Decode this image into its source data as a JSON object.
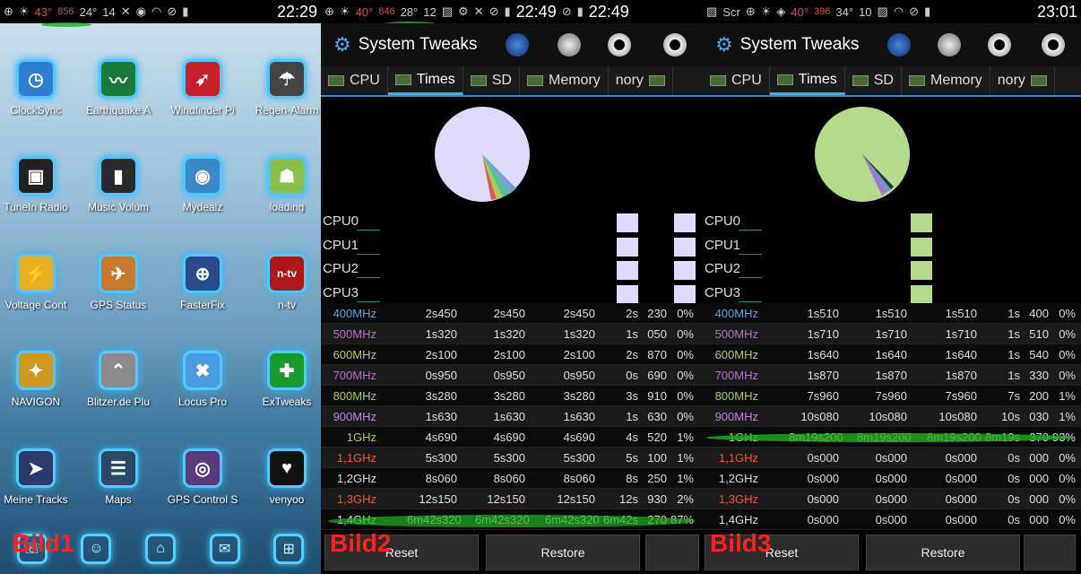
{
  "bild1": {
    "label": "Bild1",
    "statusbar": {
      "temp": "43°",
      "mah": "856",
      "b": "24°",
      "c": "14",
      "time": "22:29"
    },
    "apps": [
      {
        "label": "ClockSync",
        "icon": "clock-icon",
        "glyph": "◷",
        "color": "#2f7fd0"
      },
      {
        "label": "Earthquake A",
        "icon": "seismograph-icon",
        "glyph": "〰",
        "color": "#1a7a3a"
      },
      {
        "label": "Windfinder Pi",
        "icon": "windfinder-icon",
        "glyph": "➶",
        "color": "#c8202a"
      },
      {
        "label": "Regen-Alarm",
        "icon": "rain-cloud-icon",
        "glyph": "☂",
        "color": "#444"
      },
      {
        "label": "TuneIn Radio",
        "icon": "radio-icon",
        "glyph": "▣",
        "color": "#222"
      },
      {
        "label": "Music Volum",
        "icon": "equalizer-icon",
        "glyph": "▮",
        "color": "#2a2a2a"
      },
      {
        "label": "Mydealz",
        "icon": "crocodile-icon",
        "glyph": "◉",
        "color": "#3a88c8"
      },
      {
        "label": "loading",
        "icon": "android-icon",
        "glyph": "☗",
        "color": "#8ac04a"
      },
      {
        "label": "Voltage Cont",
        "icon": "voltage-icon",
        "glyph": "⚡",
        "color": "#e8b020"
      },
      {
        "label": "GPS Status",
        "icon": "gps-status-icon",
        "glyph": "✈",
        "color": "#c87a2a"
      },
      {
        "label": "FasterFix",
        "icon": "crosshair-icon",
        "glyph": "⊕",
        "color": "#2a4a8a"
      },
      {
        "label": "n-tv",
        "icon": "ntv-icon",
        "glyph": "n-tv",
        "color": "#b01818"
      },
      {
        "label": "NAVIGON",
        "icon": "navigon-icon",
        "glyph": "✦",
        "color": "#d09a20"
      },
      {
        "label": "Blitzer.de Plu",
        "icon": "blitzer-icon",
        "glyph": "⌃",
        "color": "#8a8a8a"
      },
      {
        "label": "Locus Pro",
        "icon": "map-icon",
        "glyph": "✖",
        "color": "#4a9ae0"
      },
      {
        "label": "ExTweaks",
        "icon": "plus-icon",
        "glyph": "✚",
        "color": "#1a9a2a"
      },
      {
        "label": "Meine Tracks",
        "icon": "arrow-icon",
        "glyph": "➤",
        "color": "#2a3a6a"
      },
      {
        "label": "Maps",
        "icon": "maps-icon",
        "glyph": "☰",
        "color": "#2a4a6a"
      },
      {
        "label": "GPS Control S",
        "icon": "gps-control-icon",
        "glyph": "◎",
        "color": "#5a3a7a"
      },
      {
        "label": "venyoo",
        "icon": "venyoo-icon",
        "glyph": "♥",
        "color": "#111"
      }
    ],
    "dock": [
      {
        "icon": "phone-icon",
        "glyph": "☏"
      },
      {
        "icon": "contacts-icon",
        "glyph": "☺"
      },
      {
        "icon": "home-icon",
        "glyph": "⌂"
      },
      {
        "icon": "message-icon",
        "glyph": "✉"
      },
      {
        "icon": "apps-icon",
        "glyph": "⊞"
      }
    ]
  },
  "bild2": {
    "label": "Bild2",
    "statusbar": {
      "temp": "40°",
      "mah": "846",
      "b": "28°",
      "c": "12",
      "time": "22:49",
      "time2": "22:49"
    },
    "title": "System Tweaks",
    "tabs": [
      "CPU",
      "Times",
      "SD",
      "Memory",
      "nory"
    ],
    "cpus": [
      "CPU0",
      "CPU1",
      "CPU2",
      "CPU3"
    ],
    "pie_color": "#dcdcfa",
    "rows": [
      {
        "f": "400MHz",
        "c": "#5aa0d8",
        "v": [
          "2s450",
          "2s450",
          "2s450",
          "2s",
          "230",
          "0%"
        ]
      },
      {
        "f": "500MHz",
        "c": "#b070c0",
        "v": [
          "1s320",
          "1s320",
          "1s320",
          "1s",
          "050",
          "0%"
        ]
      },
      {
        "f": "600MHz",
        "c": "#a8d060",
        "v": [
          "2s100",
          "2s100",
          "2s100",
          "2s",
          "870",
          "0%"
        ]
      },
      {
        "f": "700MHz",
        "c": "#b070d0",
        "v": [
          "0s950",
          "0s950",
          "0s950",
          "0s",
          "690",
          "0%"
        ]
      },
      {
        "f": "800MHz",
        "c": "#a8d050",
        "v": [
          "3s280",
          "3s280",
          "3s280",
          "3s",
          "910",
          "0%"
        ]
      },
      {
        "f": "900MHz",
        "c": "#c080e0",
        "v": [
          "1s630",
          "1s630",
          "1s630",
          "1s",
          "630",
          "0%"
        ]
      },
      {
        "f": "1GHz",
        "c": "#a8d050",
        "v": [
          "4s690",
          "4s690",
          "4s690",
          "4s",
          "520",
          "1%"
        ]
      },
      {
        "f": "1,1GHz",
        "c": "#e05a40",
        "v": [
          "5s300",
          "5s300",
          "5s300",
          "5s",
          "100",
          "1%"
        ]
      },
      {
        "f": "1,2GHz",
        "c": "#dddddd",
        "v": [
          "8s060",
          "8s060",
          "8s060",
          "8s",
          "250",
          "1%"
        ]
      },
      {
        "f": "1,3GHz",
        "c": "#e05a40",
        "v": [
          "12s150",
          "12s150",
          "12s150",
          "12s",
          "930",
          "2%"
        ]
      },
      {
        "f": "1,4GHz",
        "c": "#dddddd",
        "v": [
          "6m42s320",
          "6m42s320",
          "6m42s320",
          "6m42s",
          "270",
          "87%"
        ]
      }
    ],
    "reset": "Reset",
    "restore": "Restore"
  },
  "bild3": {
    "label": "Bild3",
    "statusbar": {
      "scr": "Scr",
      "temp": "40°",
      "mah": "396",
      "b": "34°",
      "c": "10",
      "time": "23:01"
    },
    "title": "System Tweaks",
    "tabs": [
      "CPU",
      "Times",
      "SD",
      "Memory",
      "nory"
    ],
    "cpus": [
      "CPU0",
      "CPU1",
      "CPU2",
      "CPU3"
    ],
    "pie_color": "#b4db8a",
    "rows": [
      {
        "f": "400MHz",
        "c": "#5aa0d8",
        "v": [
          "1s510",
          "1s510",
          "1s510",
          "1s",
          "400",
          "0%"
        ]
      },
      {
        "f": "500MHz",
        "c": "#b070c0",
        "v": [
          "1s710",
          "1s710",
          "1s710",
          "1s",
          "510",
          "0%"
        ]
      },
      {
        "f": "600MHz",
        "c": "#a8d060",
        "v": [
          "1s640",
          "1s640",
          "1s640",
          "1s",
          "540",
          "0%"
        ]
      },
      {
        "f": "700MHz",
        "c": "#b070d0",
        "v": [
          "1s870",
          "1s870",
          "1s870",
          "1s",
          "330",
          "0%"
        ]
      },
      {
        "f": "800MHz",
        "c": "#a8d050",
        "v": [
          "7s960",
          "7s960",
          "7s960",
          "7s",
          "200",
          "1%"
        ]
      },
      {
        "f": "900MHz",
        "c": "#c080e0",
        "v": [
          "10s080",
          "10s080",
          "10s080",
          "10s",
          "030",
          "1%"
        ]
      },
      {
        "f": "1GHz",
        "c": "#a8d050",
        "v": [
          "8m19s200",
          "8m19s200",
          "8m19s200",
          "8m19s",
          "370",
          "93%"
        ]
      },
      {
        "f": "1,1GHz",
        "c": "#e05a40",
        "v": [
          "0s000",
          "0s000",
          "0s000",
          "0s",
          "000",
          "0%"
        ]
      },
      {
        "f": "1,2GHz",
        "c": "#dddddd",
        "v": [
          "0s000",
          "0s000",
          "0s000",
          "0s",
          "000",
          "0%"
        ]
      },
      {
        "f": "1,3GHz",
        "c": "#e05a40",
        "v": [
          "0s000",
          "0s000",
          "0s000",
          "0s",
          "000",
          "0%"
        ]
      },
      {
        "f": "1,4GHz",
        "c": "#dddddd",
        "v": [
          "0s000",
          "0s000",
          "0s000",
          "0s",
          "000",
          "0%"
        ]
      }
    ],
    "reset": "Reset",
    "restore": "Restore"
  }
}
